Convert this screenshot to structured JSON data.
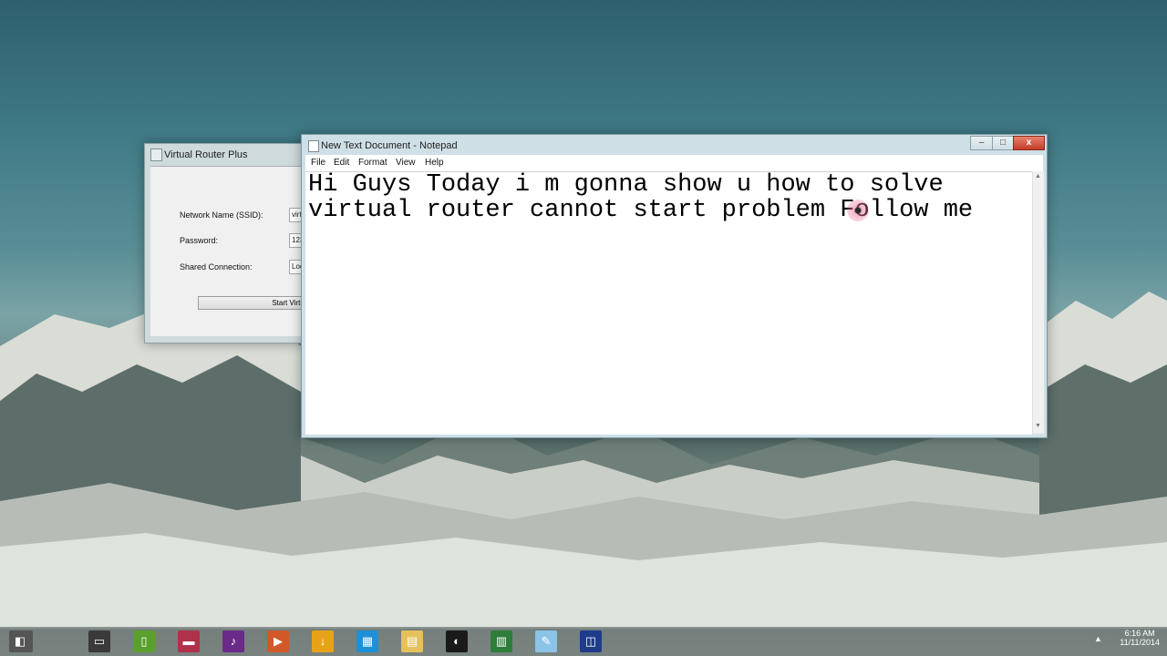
{
  "virtual_router": {
    "title": "Virtual Router Plus",
    "network_name_label": "Network Name (SSID):",
    "network_name_value": "virt",
    "password_label": "Password:",
    "password_value": "123",
    "shared_connection_label": "Shared Connection:",
    "shared_connection_value": "Loc",
    "start_button": "Start Virtual"
  },
  "notepad": {
    "title": "New Text Document - Notepad",
    "menu": [
      "File",
      "Edit",
      "Format",
      "View",
      "Help"
    ],
    "text_lines": [
      "Hi Guys Today i m gonna show u how to solve",
      "virtual router cannot start problem Follow me"
    ],
    "minimize": "–",
    "maximize": "□",
    "close": "x",
    "scroll_up": "▲",
    "scroll_down": "▼"
  },
  "taskbar": {
    "icons": [
      {
        "name": "desktop-app-icon",
        "color": "#3a3a3a",
        "glyph": "▭"
      },
      {
        "name": "green-document-icon",
        "color": "#5aa02c",
        "glyph": "▯"
      },
      {
        "name": "red-app-icon",
        "color": "#b0314a",
        "glyph": "▬"
      },
      {
        "name": "music-icon",
        "color": "#6a2a8a",
        "glyph": "♪"
      },
      {
        "name": "video-icon",
        "color": "#d2582a",
        "glyph": "▶"
      },
      {
        "name": "download-icon",
        "color": "#e8a21a",
        "glyph": "↓"
      },
      {
        "name": "store-icon",
        "color": "#1f8fd6",
        "glyph": "▦"
      },
      {
        "name": "file-explorer-icon",
        "color": "#e6c05a",
        "glyph": "▤"
      },
      {
        "name": "browser-icon",
        "color": "#1a1a1a",
        "glyph": "◐"
      },
      {
        "name": "chart-app-icon",
        "color": "#2e7d3a",
        "glyph": "▥"
      },
      {
        "name": "notepad-icon",
        "color": "#8cc4e8",
        "glyph": "✎"
      },
      {
        "name": "virtual-router-icon",
        "color": "#1e3c8a",
        "glyph": "◫"
      }
    ],
    "time": "6:16 AM",
    "date": "11/11/2014",
    "tray_arrow": "▲"
  },
  "colors": {
    "close_button": "#c43c28",
    "titlebar": "#cfdfe6"
  }
}
